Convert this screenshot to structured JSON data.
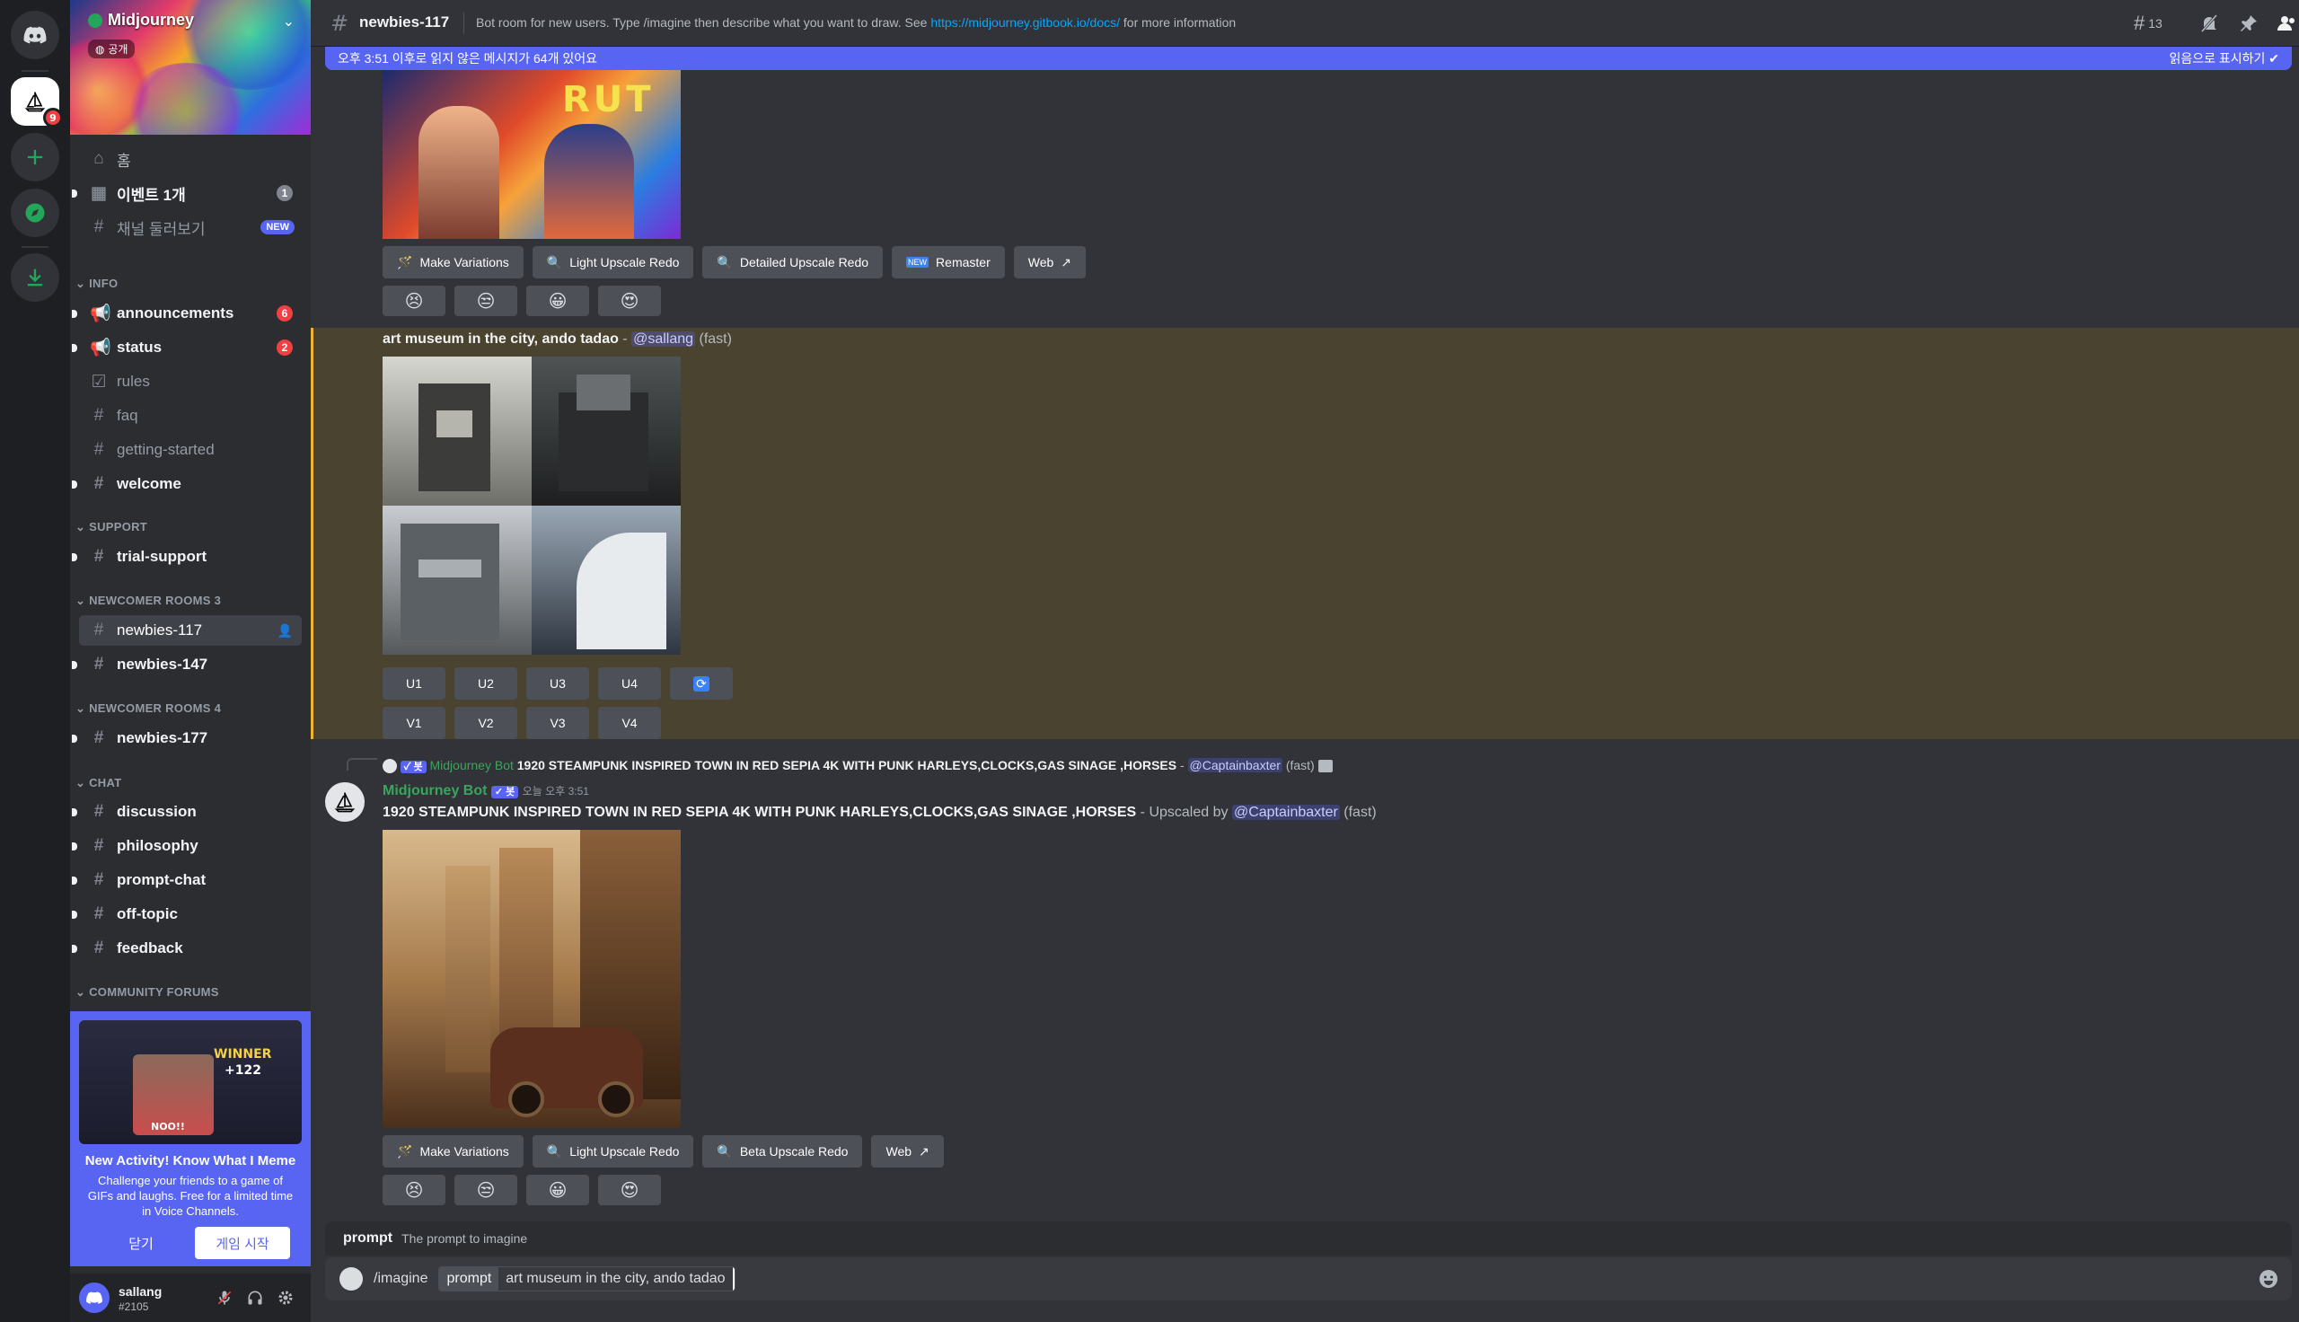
{
  "server": {
    "name": "Midjourney",
    "public_label": "공개"
  },
  "rail": {
    "mention_count": "9"
  },
  "sidebar": {
    "top_items": [
      {
        "label": "홈"
      },
      {
        "label": "이벤트 1개",
        "badge": "1"
      },
      {
        "label": "채널 둘러보기",
        "badge": "NEW"
      }
    ],
    "categories": {
      "info": "INFO",
      "support": "SUPPORT",
      "newcomer3": "NEWCOMER ROOMS 3",
      "newcomer4": "NEWCOMER ROOMS 4",
      "chat": "CHAT",
      "forums": "COMMUNITY FORUMS"
    },
    "channels": {
      "announcements": {
        "label": "announcements",
        "badge": "6"
      },
      "status": {
        "label": "status",
        "badge": "2"
      },
      "rules": {
        "label": "rules"
      },
      "faq": {
        "label": "faq"
      },
      "getting_started": {
        "label": "getting-started"
      },
      "welcome": {
        "label": "welcome"
      },
      "trial_support": {
        "label": "trial-support"
      },
      "newbies_117": {
        "label": "newbies-117"
      },
      "newbies_147": {
        "label": "newbies-147"
      },
      "newbies_177": {
        "label": "newbies-177"
      },
      "discussion": {
        "label": "discussion"
      },
      "philosophy": {
        "label": "philosophy"
      },
      "prompt_chat": {
        "label": "prompt-chat"
      },
      "off_topic": {
        "label": "off-topic"
      },
      "feedback": {
        "label": "feedback"
      }
    },
    "activity": {
      "title": "New Activity! Know What I Meme",
      "description": "Challenge your friends to a game of GIFs and laughs. Free for a limited time in Voice Channels.",
      "close_label": "닫기",
      "start_label": "게임 시작",
      "winner_text": "WINNER",
      "score_text": "+122",
      "noo_text": "NOO!!"
    }
  },
  "user": {
    "name": "sallang",
    "tag": "#2105"
  },
  "header": {
    "channel_name": "newbies-117",
    "topic_prefix": "Bot room for new users. Type /imagine then describe what you want to draw. See ",
    "topic_link": "https://midjourney.gitbook.io/docs/",
    "topic_suffix": " for more information",
    "thread_count": "13"
  },
  "unread_bar": {
    "text": "오후 3:51 이후로 읽지 않은 메시지가 64개 있어요",
    "mark_read": "읽음으로 표시하기"
  },
  "messages": {
    "first_actions": {
      "make_variations": "Make Variations",
      "light_upscale_redo": "Light Upscale Redo",
      "detailed_upscale_redo": "Detailed Upscale Redo",
      "remaster": "Remaster",
      "web": "Web"
    },
    "reactions": [
      "😣",
      "😒",
      "😀",
      "😍"
    ],
    "grid_message": {
      "prompt": "art museum in the city, ando tadao",
      "separator": " - ",
      "mention": "@sallang",
      "mode": "(fast)",
      "upscale_buttons": [
        "U1",
        "U2",
        "U3",
        "U4"
      ],
      "variation_buttons": [
        "V1",
        "V2",
        "V3",
        "V4"
      ]
    },
    "reply_ref": {
      "author": "Midjourney Bot",
      "prompt": "1920 STEAMPUNK INSPIRED TOWN IN RED SEPIA 4K WITH PUNK HARLEYS,CLOCKS,GAS SINAGE ,HORSES",
      "separator": " - ",
      "mention": "@Captainbaxter",
      "mode": "(fast)"
    },
    "upscale_message": {
      "author": "Midjourney Bot",
      "badge": "✓ 봇",
      "timestamp": "오늘 오후 3:51",
      "prompt": "1920 STEAMPUNK INSPIRED TOWN IN RED SEPIA 4K WITH PUNK HARLEYS,CLOCKS,GAS SINAGE ,HORSES",
      "upscaled_by": " - Upscaled by ",
      "mention": "@Captainbaxter",
      "mode": "(fast)",
      "actions": {
        "make_variations": "Make Variations",
        "light_upscale_redo": "Light Upscale Redo",
        "beta_upscale_redo": "Beta Upscale Redo",
        "web": "Web"
      }
    }
  },
  "prompt_hint": {
    "name": "prompt",
    "description": "The prompt to imagine"
  },
  "composer": {
    "command": "/imagine",
    "option_name": "prompt",
    "option_value": "art museum in the city, ando tadao"
  },
  "colors": {
    "accent": "#5865f2",
    "highlight": "#4a4330",
    "highlight_bar": "#f0b232",
    "bot_name": "#3ba55d",
    "link": "#00a8fc"
  }
}
